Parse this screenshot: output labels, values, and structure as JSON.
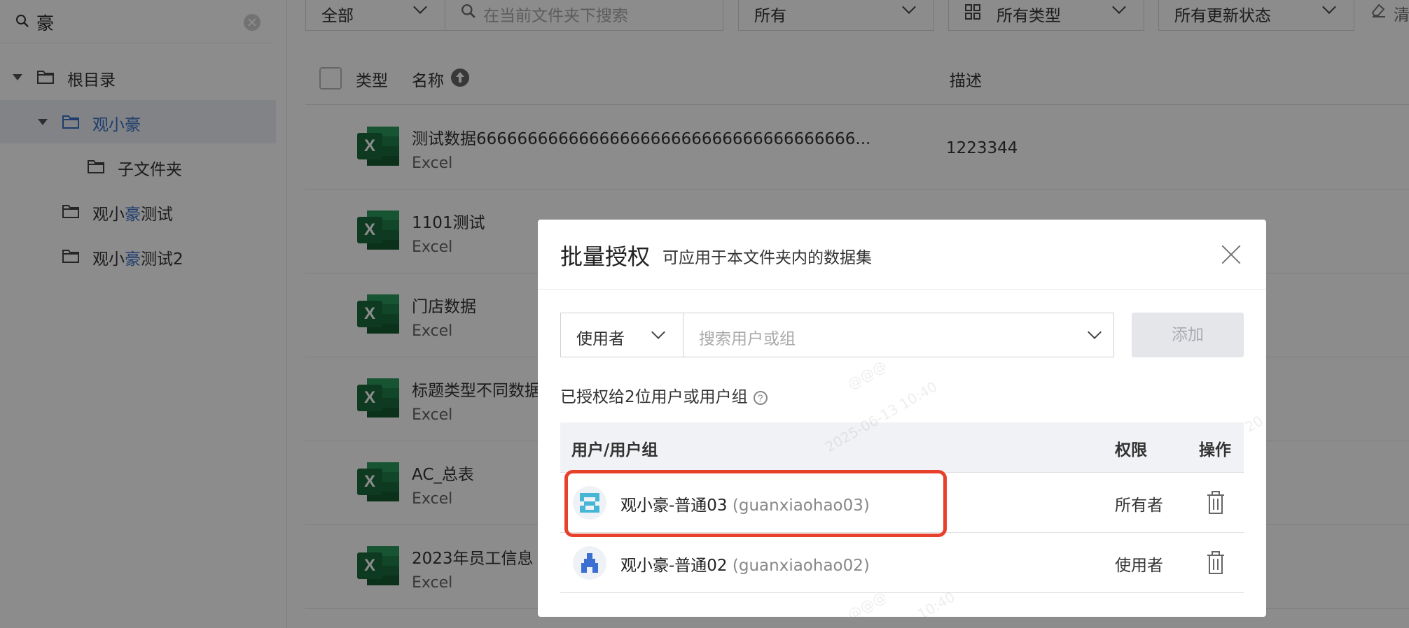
{
  "sidebar": {
    "search_query": "豪",
    "tree": [
      {
        "label": "根目录",
        "selected": false
      },
      {
        "label_pre": "观小",
        "label_hl": "豪",
        "label_post": "",
        "selected": true
      },
      {
        "label": "子文件夹",
        "selected": false
      },
      {
        "label_pre": "观小",
        "label_hl": "豪",
        "label_post": "测试",
        "selected": false
      },
      {
        "label_pre": "观小",
        "label_hl": "豪",
        "label_post": "测试2",
        "selected": false
      }
    ]
  },
  "filters": {
    "scope": "全部",
    "search_placeholder": "在当前文件夹下搜索",
    "owner": "所有",
    "type": "所有类型",
    "status": "所有更新状态",
    "clear_label": "清"
  },
  "list": {
    "headers": {
      "type": "类型",
      "name": "名称",
      "desc": "描述"
    },
    "rows": [
      {
        "name": "测试数据6666666666666666666666666666666666666...",
        "type": "Excel",
        "desc": "1223344"
      },
      {
        "name": "1101测试",
        "type": "Excel",
        "desc": ""
      },
      {
        "name": "门店数据",
        "type": "Excel",
        "desc": ""
      },
      {
        "name": "标题类型不同数据",
        "type": "Excel",
        "desc": ""
      },
      {
        "name": "AC_总表",
        "type": "Excel",
        "desc": ""
      },
      {
        "name": "2023年员工信息",
        "type": "Excel",
        "desc": ""
      }
    ],
    "excel_badge": "X"
  },
  "modal": {
    "title": "批量授权",
    "subtitle": "可应用于本文件夹内的数据集",
    "role_select": "使用者",
    "user_search_placeholder": "搜索用户或组",
    "add_label": "添加",
    "granted_text": "已授权给2位用户或用户组",
    "help_glyph": "?",
    "table_headers": {
      "user": "用户/用户组",
      "permission": "权限",
      "action": "操作"
    },
    "users": [
      {
        "name": "观小豪-普通03",
        "account": "(guanxiaohao03)",
        "permission": "所有者"
      },
      {
        "name": "观小豪-普通02",
        "account": "(guanxiaohao02)",
        "permission": "使用者"
      }
    ],
    "watermarks": [
      "@@@",
      "2025-06-13 10:40",
      "@@@",
      "10:40",
      "20"
    ]
  },
  "colors": {
    "accent": "#3a6fc8",
    "highlight_box": "#e8412b",
    "excel_green": "#1f7a47"
  }
}
